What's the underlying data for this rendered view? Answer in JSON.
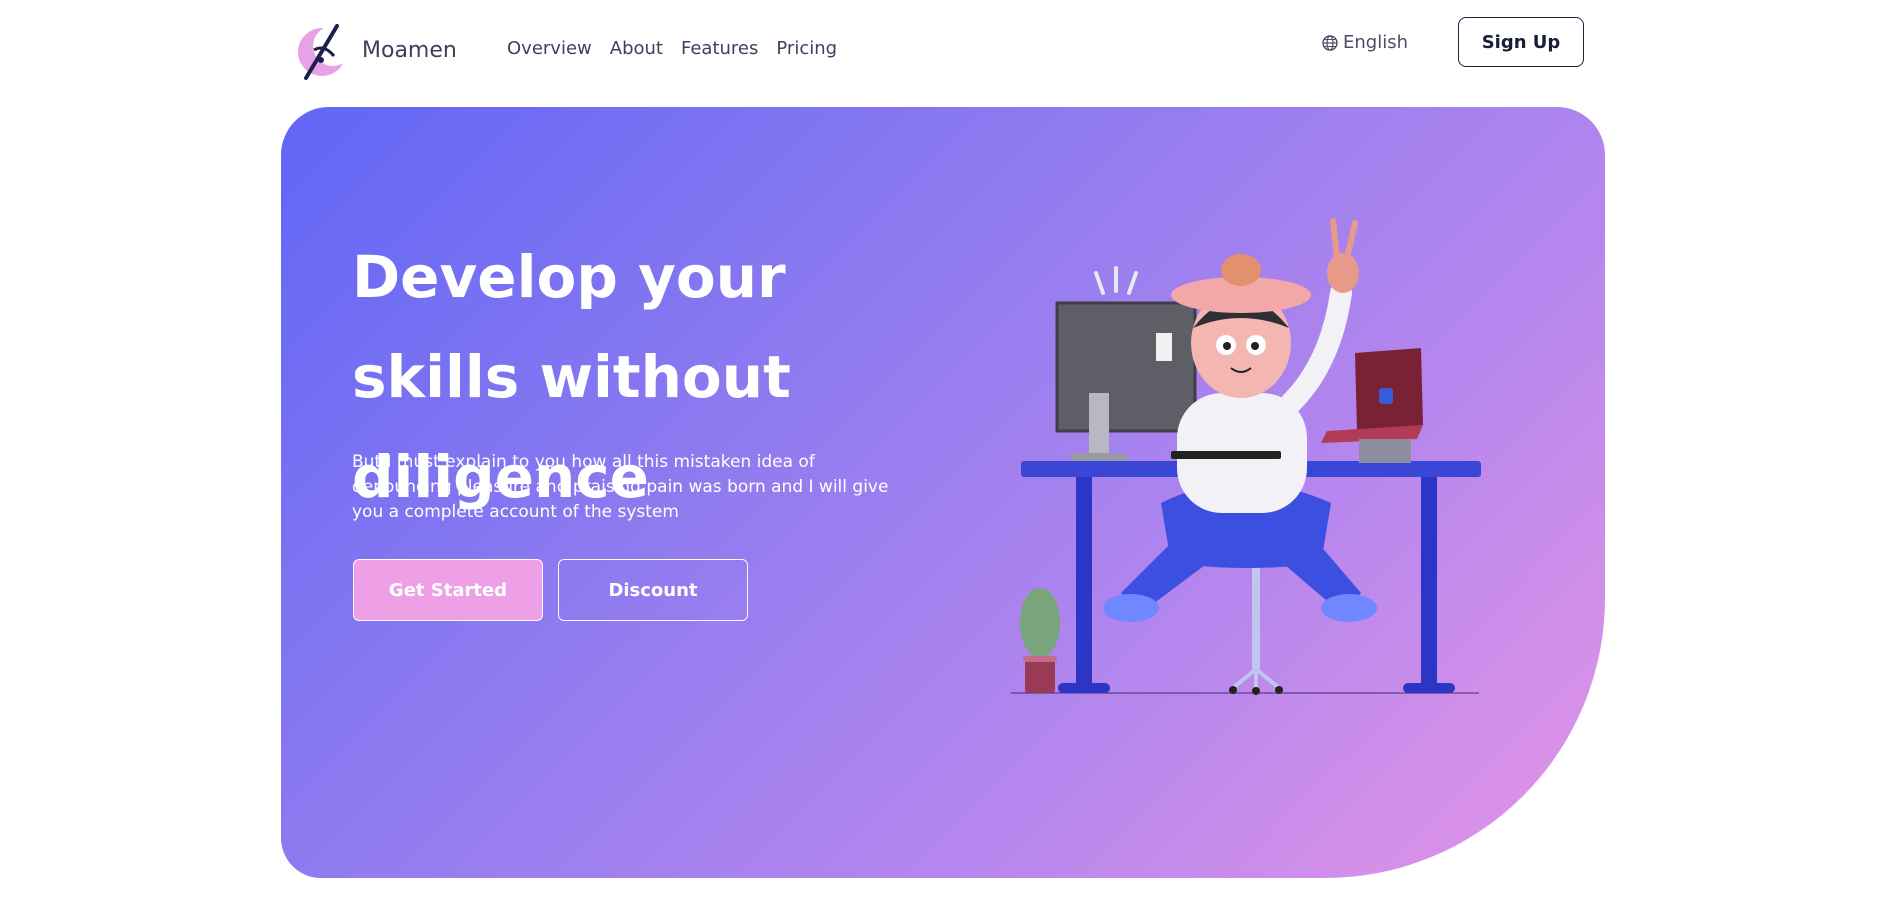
{
  "brand": {
    "name": "Moamen",
    "logo_icon": "crescent-pen-logo"
  },
  "nav": {
    "links": [
      "Overview",
      "About",
      "Features",
      "Pricing"
    ]
  },
  "language": {
    "label": "English",
    "icon": "globe-icon"
  },
  "signup": {
    "label": "Sign Up"
  },
  "hero": {
    "title": "Develop your skills without diligence",
    "text": "But I must explain to you how all this mistaken idea of denouncing pleasure and praising pain was born and I will give you a complete account of the system",
    "primary_button": "Get Started",
    "secondary_button": "Discount",
    "illustration": "3d-character-at-desk-illustration"
  },
  "colors": {
    "gradient_start": "#6066f6",
    "gradient_end": "#e595e6",
    "primary_button": "#eda0e6",
    "text_dark": "#1a1d3a"
  }
}
